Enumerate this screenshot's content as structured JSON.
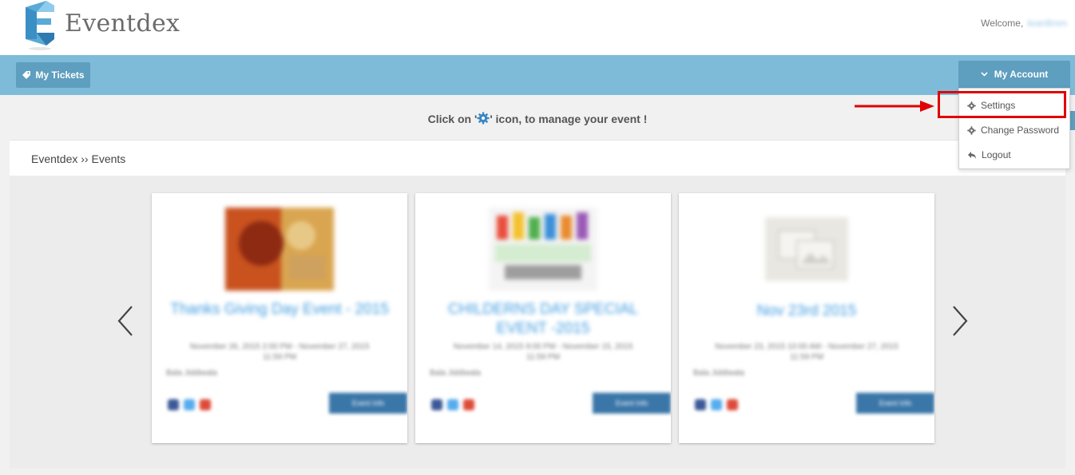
{
  "header": {
    "brand": "Eventdex",
    "welcome_label": "Welcome,",
    "username": "lean8mm"
  },
  "nav": {
    "tickets_label": "My Tickets",
    "account_label": "My Account"
  },
  "dropdown": {
    "items": [
      {
        "label": "Settings",
        "icon": "gear-icon"
      },
      {
        "label": "Change Password",
        "icon": "gear-icon"
      },
      {
        "label": "Logout",
        "icon": "reply-icon"
      }
    ]
  },
  "hint": {
    "before": "Click on '",
    "after": "' icon, to manage your event !"
  },
  "breadcrumb": "Eventdex ›› Events",
  "events": [
    {
      "title": "Thanks Giving Day Event - 2015",
      "date": "November 26, 2015 2:00 PM - November 27, 2015 11:59 PM",
      "location": "Bala Jiddiwala",
      "button": "Event Info"
    },
    {
      "title": "CHILDERNS DAY SPECIAL EVENT -2015",
      "date": "November 14, 2015 9:00 PM - November 15, 2015 11:59 PM",
      "location": "Bala Jiddiwala",
      "button": "Event Info"
    },
    {
      "title": "Nov 23rd 2015",
      "date": "November 23, 2015 10:00 AM - November 27, 2015 11:59 PM",
      "location": "Bala Jiddiwala",
      "button": "Event Info"
    }
  ],
  "colors": {
    "navbar": "#7dbbd9",
    "button": "#5e9ebf",
    "link": "#3e9be0",
    "highlight": "#e00000"
  }
}
